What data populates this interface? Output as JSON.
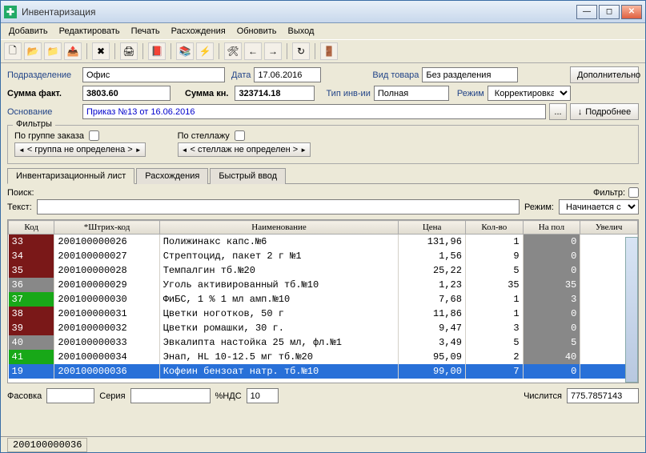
{
  "window": {
    "title": "Инвентаризация"
  },
  "menu": [
    "Добавить",
    "Редактировать",
    "Печать",
    "Расхождения",
    "Обновить",
    "Выход"
  ],
  "form": {
    "subdivision_lbl": "Подразделение",
    "subdivision_val": "Офис",
    "date_lbl": "Дата",
    "date_val": "17.06.2016",
    "product_kind_lbl": "Вид товара",
    "product_kind_val": "Без разделения",
    "extra_btn": "Дополнительно",
    "sum_fact_lbl": "Сумма факт.",
    "sum_fact_val": "3803.60",
    "sum_book_lbl": "Сумма кн.",
    "sum_book_val": "323714.18",
    "inv_type_lbl": "Тип инв-ии",
    "inv_type_val": "Полная",
    "mode_lbl": "Режим",
    "mode_val": "Корректировка",
    "basis_lbl": "Основание",
    "basis_val": "Приказ №13 от 16.06.2016",
    "detail_btn": "Подробнее"
  },
  "filters": {
    "title": "Фильтры",
    "group_lbl": "По группе заказа",
    "group_val": "< группа не определена >",
    "shelf_lbl": "По стеллажу",
    "shelf_val": "< стеллаж не определен >"
  },
  "tabs": [
    "Инвентаризационный лист",
    "Расхождения",
    "Быстрый ввод"
  ],
  "search": {
    "search_lbl": "Поиск:",
    "text_lbl": "Текст:",
    "mode_lbl": "Режим:",
    "mode_val": "Начинается с",
    "filter_lbl": "Фильтр:"
  },
  "table": {
    "headers": [
      "Код",
      "*Штрих-код",
      "Наименование",
      "Цена",
      "Кол-во",
      "На пол",
      "Увелич"
    ],
    "rows": [
      {
        "code": "33",
        "color": "c-dark",
        "barcode": "200100000026",
        "name": "Полижинакс капс.№6",
        "price": "131,96",
        "qty": "1",
        "pol": "0"
      },
      {
        "code": "34",
        "color": "c-dark",
        "barcode": "200100000027",
        "name": "Стрептоцид, пакет 2 г №1",
        "price": "1,56",
        "qty": "9",
        "pol": "0"
      },
      {
        "code": "35",
        "color": "c-dark",
        "barcode": "200100000028",
        "name": "Темпалгин тб.№20",
        "price": "25,22",
        "qty": "5",
        "pol": "0"
      },
      {
        "code": "36",
        "color": "c-gray",
        "barcode": "200100000029",
        "name": "Уголь активированный тб.№10",
        "price": "1,23",
        "qty": "35",
        "pol": "35"
      },
      {
        "code": "37",
        "color": "c-green",
        "barcode": "200100000030",
        "name": "ФиБС, 1 % 1 мл амп.№10",
        "price": "7,68",
        "qty": "1",
        "pol": "3"
      },
      {
        "code": "38",
        "color": "c-dark",
        "barcode": "200100000031",
        "name": "Цветки ноготков, 50 г",
        "price": "11,86",
        "qty": "1",
        "pol": "0"
      },
      {
        "code": "39",
        "color": "c-dark",
        "barcode": "200100000032",
        "name": "Цветки ромашки, 30 г.",
        "price": "9,47",
        "qty": "3",
        "pol": "0"
      },
      {
        "code": "40",
        "color": "c-gray",
        "barcode": "200100000033",
        "name": "Эвкалипта настойка 25 мл, фл.№1",
        "price": "3,49",
        "qty": "5",
        "pol": "5"
      },
      {
        "code": "41",
        "color": "c-green",
        "barcode": "200100000034",
        "name": "Энап, HL 10-12.5 мг тб.№20",
        "price": "95,09",
        "qty": "2",
        "pol": "40"
      },
      {
        "code": "19",
        "color": "sel",
        "barcode": "200100000036",
        "name": "Кофеин бензоат натр. тб.№10",
        "price": "99,00",
        "qty": "7",
        "pol": "0"
      }
    ]
  },
  "footer": {
    "pack_lbl": "Фасовка",
    "series_lbl": "Серия",
    "vat_lbl": "%НДС",
    "vat_val": "10",
    "counted_lbl": "Числится",
    "counted_val": "775.7857143"
  },
  "statusbar": {
    "text": "200100000036"
  }
}
